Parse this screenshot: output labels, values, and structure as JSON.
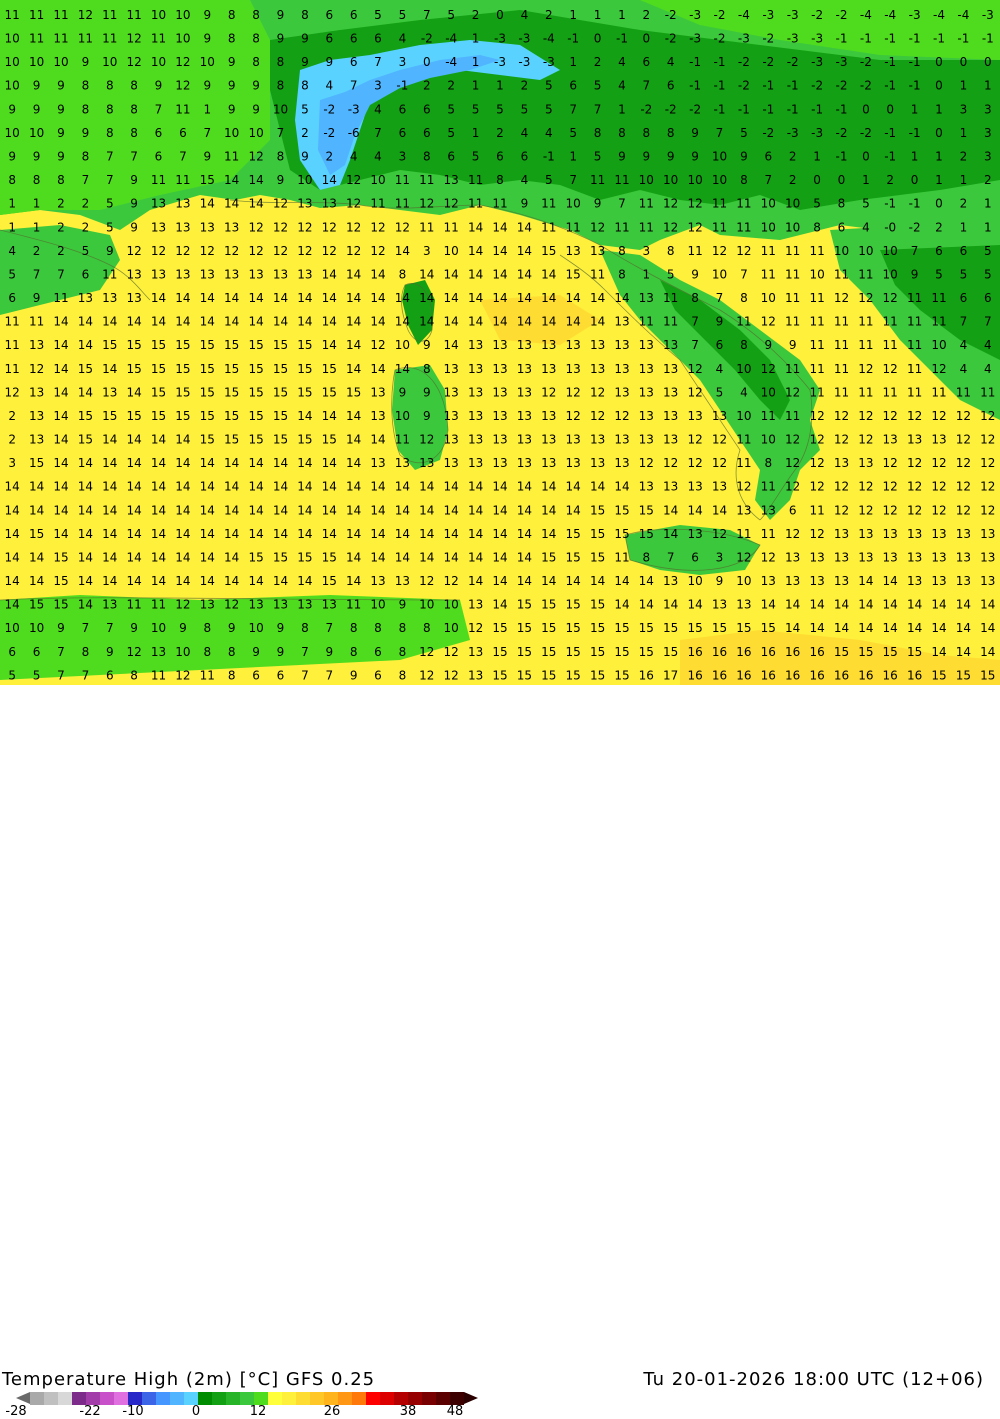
{
  "title": "Temperature High (2m) [°C] GFS 0.25",
  "valid_time": "Tu 20-01-2026 18:00 UTC (12+06)",
  "colorbar": {
    "tick_labels": [
      "-28",
      "-22",
      "-10",
      "0",
      "12",
      "26",
      "38",
      "48"
    ],
    "colors": [
      "#a9a9a9",
      "#c0c0c0",
      "#d8d8d8",
      "#7d2b8b",
      "#a23ca8",
      "#c850c8",
      "#e070e0",
      "#2828c8",
      "#3c64e6",
      "#4696ff",
      "#50b4ff",
      "#5ad2ff",
      "#008c00",
      "#14a014",
      "#28b428",
      "#3cc83c",
      "#50dc1e",
      "#ffff3c",
      "#fff03c",
      "#ffdc32",
      "#ffc828",
      "#ffb41e",
      "#ff9614",
      "#ff780a",
      "#ff0000",
      "#dc0000",
      "#b40000",
      "#960000",
      "#780000",
      "#5a0000",
      "#3c0000"
    ]
  },
  "temperature_grid": {
    "rows": [
      "11 11 11 12 11 11 10 10 9 8 8 9 8 6 6 5 5 7 5 2 0 4 2 1 1 1 2 -2 -3 -2 -4 -3 -3 -2 -2 -4 -4 -3 -4 -4 -3",
      "10 11 11 11 11 12 11 10 9 8 8 9 9 6 6 6 4 -2 -4 1 -3 -3 -4 -1 0 -1 0 -2 -3 -2 -3 -2 -3 -3 -1 -1 -1 -1 -1 -1 -1",
      "10 10 10 9 10 12 10 12 10 9 8 8 9 9 6 7 3 0 -4 1 -3 -3 -3 1 2 4 6 4 -1 -1 -2 -2 -2 -3 -3 -2 -1 -1 0 0 0",
      "10 9 9 8 8 8 9 12 9 9 9 8 8 4 7 3 -1 2 2 1 1 2 5 6 5 4 7 6 -1 -1 -2 -1 -1 -2 -2 -2 -1 -1 0 1 1",
      "9 9 9 8 8 8 7 11 1 9 9 10 5 -2 -3 4 6 6 5 5 5 5 5 7 7 1 -2 -2 -2 -1 -1 -1 -1 -1 -1 0 0 1 1 3 3",
      "10 10 9 9 8 8 6 6 7 10 10 7 2 -2 -6 7 6 6 5 1 2 4 4 5 8 8 8 8 9 7 5 -2 -3 -3 -2 -2 -1 -1 0 1 3",
      "9 9 9 8 7 7 6 7 9 11 12 8 9 2 4 4 3 8 6 5 6 6 -1 1 5 9 9 9 9 10 9 6 2 1 -1 0 -1 1 1 2 3",
      "8 8 8 7 7 9 11 11 15 14 14 9 10 14 12 10 11 11 13 11 8 4 5 7 11 11 10 10 10 10 8 7 2 0 0 1 2 0 1 1 2",
      "1 1 2 2 5 9 13 13 14 14 14 12 13 13 12 11 11 12 12 11 11 9 11 10 9 7 11 12 12 11 11 10 10 5 8 5 -1 -1 0 2 1",
      "1 1 2 2 5 9 13 13 13 13 12 12 12 12 12 12 12 11 11 14 14 14 11 11 12 11 11 12 12 11 11 10 10 8 6 4 -0 -2 2 1 1",
      "4 2 2 5 9 12 12 12 12 12 12 12 12 12 12 12 14 3 10 14 14 14 15 13 13 8 3 8 11 12 12 11 11 11 10 10 10 7 6 6 5",
      "5 7 7 6 11 13 13 13 13 13 13 13 13 14 14 14 8 14 14 14 14 14 14 15 11 8 1 5 9 10 7 11 11 10 11 11 10 9 5 5 5",
      "6 9 11 13 13 13 14 14 14 14 14 14 14 14 14 14 14 14 14 14 14 14 14 14 14 14 13 11 8 7 8 10 11 11 12 12 12 11 11 6 6",
      "11 11 14 14 14 14 14 14 14 14 14 14 14 14 14 14 14 14 14 14 14 14 14 14 14 13 11 11 7 9 11 12 11 11 11 11 11 11 11 7 7",
      "11 13 14 14 15 15 15 15 15 15 15 15 15 14 14 12 10 9 14 13 13 13 13 13 13 13 13 13 7 6 8 9 9 11 11 11 11 11 10 4 4",
      "11 12 14 15 14 15 15 15 15 15 15 15 15 15 14 14 14 8 13 13 13 13 13 13 13 13 13 13 12 4 10 12 11 11 11 12 12 11 12 4 4",
      "12 13 14 14 13 14 15 15 15 15 15 15 15 15 15 13 9 9 13 13 13 13 12 12 12 13 13 13 12 5 4 10 12 11 11 11 11 11 11 11 11",
      "2 13 14 15 15 15 15 15 15 15 15 15 14 14 14 13 10 9 13 13 13 13 13 12 12 12 13 13 13 13 10 11 11 12 12 12 12 12 12 12 12",
      "2 13 14 15 14 14 14 14 15 15 15 15 15 15 14 14 11 12 13 13 13 13 13 13 13 13 13 13 12 12 11 10 12 12 12 12 13 13 13 12 12",
      "3 15 14 14 14 14 14 14 14 14 14 14 14 14 14 13 13 13 13 13 13 13 13 13 13 13 12 12 12 12 11 8 12 12 13 13 12 12 12 12 12",
      "14 14 14 14 14 14 14 14 14 14 14 14 14 14 14 14 14 14 14 14 14 14 14 14 14 14 13 13 13 13 12 11 12 12 12 12 12 12 12 12 12",
      "14 14 14 14 14 14 14 14 14 14 14 14 14 14 14 14 14 14 14 14 14 14 14 14 15 15 15 14 14 14 13 13 6 11 12 12 12 12 12 12 12",
      "14 15 14 14 14 14 14 14 14 14 14 14 14 14 14 14 14 14 14 14 14 14 14 15 15 15 15 14 13 12 11 11 12 12 13 13 13 13 13 13 13",
      "14 14 15 14 14 14 14 14 14 14 15 15 15 15 14 14 14 14 14 14 14 14 15 15 15 11 8 7 6 3 12 12 13 13 13 13 13 13 13 13 13",
      "14 14 15 14 14 14 14 14 14 14 14 14 14 15 14 13 13 12 12 14 14 14 14 14 14 14 14 13 10 9 10 13 13 13 13 14 14 13 13 13 13",
      "14 15 15 14 13 11 11 12 13 12 13 13 13 13 11 10 9 10 10 13 14 15 15 15 15 14 14 14 14 13 13 14 14 14 14 14 14 14 14 14 14",
      "10 10 9 7 7 9 10 9 8 9 10 9 8 7 8 8 8 8 10 12 15 15 15 15 15 15 15 15 15 15 15 15 14 14 14 14 14 14 14 14 14",
      "6 6 7 8 9 12 13 10 8 8 9 9 7 9 8 6 8 12 12 13 15 15 15 15 15 15 15 15 16 16 16 16 16 16 15 15 15 15 14 14 14",
      "5 5 7 7 6 8 11 12 11 8 6 6 7 7 9 6 8 12 12 13 15 15 15 15 15 15 16 17 16 16 16 16 16 16 16 16 16 16 15 15 15"
    ]
  }
}
